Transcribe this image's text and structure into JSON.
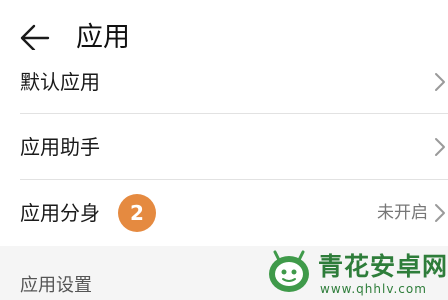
{
  "header": {
    "title": "应用",
    "back_icon": "arrow-left-icon"
  },
  "items": [
    {
      "label": "默认应用",
      "icon": "chevron-right-icon"
    },
    {
      "label": "应用助手",
      "icon": "chevron-right-icon"
    },
    {
      "label": "应用分身",
      "badge": "2",
      "status": "未开启",
      "icon": "chevron-right-icon"
    }
  ],
  "section": {
    "title": "应用设置"
  },
  "watermark": {
    "text": "青花安卓网",
    "url": "www.qhhlv.com"
  },
  "colors": {
    "badge": "#e58a40",
    "watermark": "#2e7d3a",
    "background": "#f5f5f5"
  }
}
